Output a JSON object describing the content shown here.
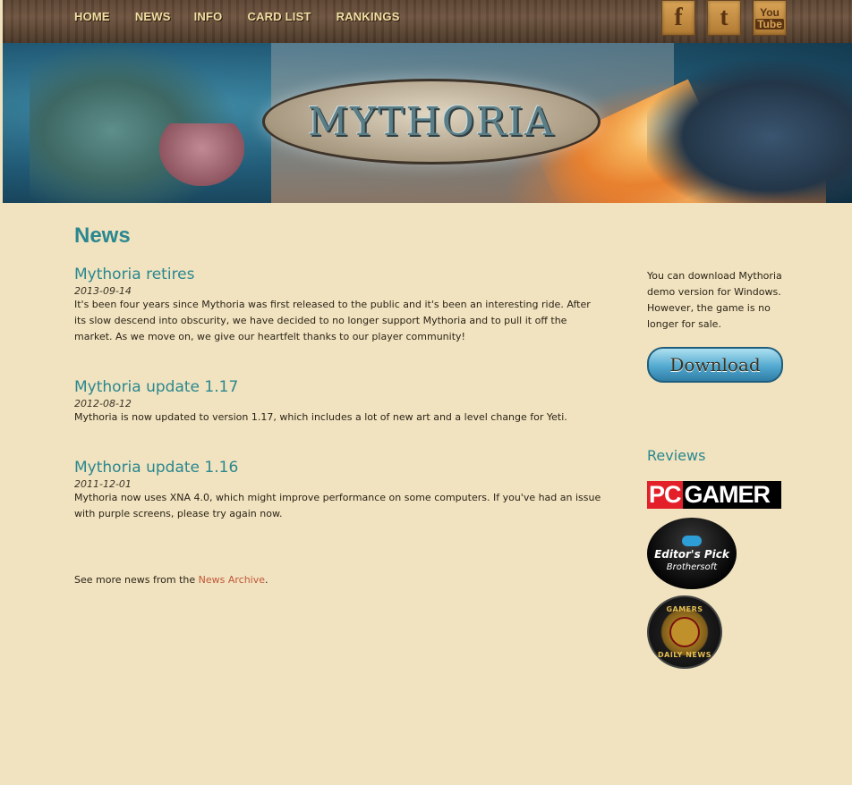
{
  "nav": {
    "items": [
      "HOME",
      "NEWS",
      "INFO",
      "CARD LIST",
      "RANKINGS"
    ]
  },
  "socials": {
    "facebook_label": "f",
    "twitter_label": "t",
    "youtube_you": "You",
    "youtube_tube": "Tube"
  },
  "banner": {
    "logo_text": "MYTHORIA"
  },
  "main": {
    "heading": "News",
    "posts": [
      {
        "title": "Mythoria retires",
        "date": "2013-09-14",
        "body": "It's been four years since Mythoria was first released to the public and it's been an interesting ride. After its slow descend into obscurity, we have decided to no longer support Mythoria and to pull it off the market. As we move on, we give our heartfelt thanks to our player community!"
      },
      {
        "title": "Mythoria update 1.17",
        "date": "2012-08-12",
        "body": "Mythoria is now updated to version 1.17, which includes a lot of new art and a level change for Yeti."
      },
      {
        "title": "Mythoria update 1.16",
        "date": "2011-12-01",
        "body": "Mythoria now uses XNA 4.0, which might improve performance on some computers. If you've had an issue with purple screens, please try again now."
      }
    ],
    "more_prefix": "See more news from the ",
    "more_link": "News Archive",
    "more_suffix": "."
  },
  "sidebar": {
    "download_text": "You can download Mythoria demo version for Windows. However, the game is no longer for sale.",
    "download_button": "Download",
    "reviews_heading": "Reviews",
    "pcgamer_pc": "PC",
    "pcgamer_gamer": "GAMER",
    "badge1_title": "Editor's Pick",
    "badge1_sub": "Brothersoft",
    "badge2_top": "GAMERS",
    "badge2_bottom": "DAILY NEWS"
  },
  "colors": {
    "accent": "#2a8790",
    "link": "#c0583a",
    "nav_text": "#f2dfa3",
    "background": "#f1e3bf"
  }
}
